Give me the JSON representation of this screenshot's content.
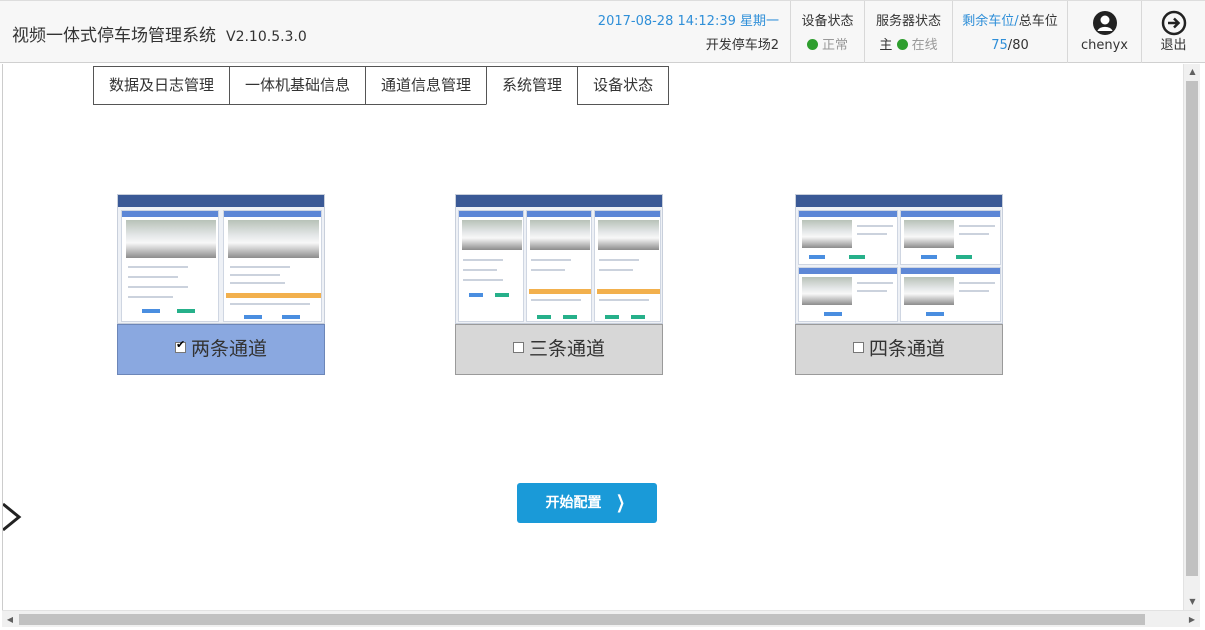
{
  "header": {
    "app_title": "视频一体式停车场管理系统",
    "version": "V2.10.5.3.0",
    "datetime": "2017-08-28 14:12:39 星期一",
    "lot_name": "开发停车场2",
    "device_status": {
      "label": "设备状态",
      "value": "正常"
    },
    "server_status": {
      "label": "服务器状态",
      "prefix": "主",
      "value": "在线"
    },
    "parking": {
      "label_remaining": "剩余车位",
      "separator": "/",
      "label_total": "总车位",
      "remaining": "75",
      "slash": "/",
      "total": "80"
    },
    "user": {
      "name": "chenyx",
      "icon": "user-circle-icon"
    },
    "exit": {
      "label": "退出",
      "icon": "exit-arrow-icon"
    }
  },
  "tabs": [
    {
      "label": "数据及日志管理"
    },
    {
      "label": "一体机基础信息"
    },
    {
      "label": "通道信息管理"
    },
    {
      "label": "系统管理",
      "active": true
    },
    {
      "label": "设备状态"
    }
  ],
  "channel_options": [
    {
      "label": "两条通道",
      "checked": true
    },
    {
      "label": "三条通道",
      "checked": false
    },
    {
      "label": "四条通道",
      "checked": false
    }
  ],
  "start_button": {
    "label": "开始配置",
    "icon": "chevron-right-icon"
  },
  "colors": {
    "accent_blue": "#1a9ad8",
    "selected_option": "#8aa8e0",
    "unselected_option": "#d7d7d7",
    "status_green": "#2e9e2e",
    "datetime_blue": "#2f8fd8"
  }
}
